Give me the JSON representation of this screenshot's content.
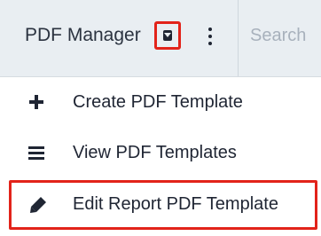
{
  "header": {
    "module_title": "PDF Manager",
    "dropdown_icon": "caret-down-icon",
    "more_icon": "kebab-menu-icon",
    "search_placeholder": "Search"
  },
  "menu": {
    "items": [
      {
        "label": "Create PDF Template",
        "icon": "plus-icon"
      },
      {
        "label": "View PDF Templates",
        "icon": "list-icon"
      },
      {
        "label": "Edit Report PDF Template",
        "icon": "pencil-icon"
      }
    ]
  },
  "colors": {
    "highlight": "#e2231a",
    "topbar_background": "#e9eef2",
    "text": "#1f2533"
  }
}
